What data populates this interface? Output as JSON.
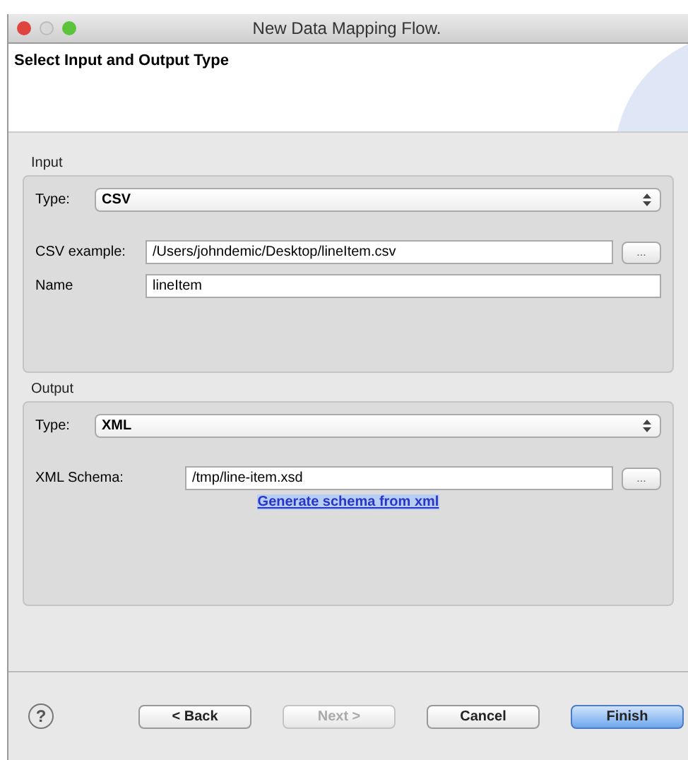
{
  "window": {
    "title": "New Data Mapping Flow."
  },
  "header": {
    "title": "Select Input and Output Type"
  },
  "input": {
    "legend": "Input",
    "type_label": "Type:",
    "type_value": "CSV",
    "fields": [
      {
        "label": "CSV example:",
        "value": "/Users/johndemic/Desktop/lineItem.csv",
        "browse": "..."
      },
      {
        "label": "Name",
        "value": "lineItem"
      }
    ]
  },
  "output": {
    "legend": "Output",
    "type_label": "Type:",
    "type_value": "XML",
    "fields": [
      {
        "label": "XML Schema:",
        "value": "/tmp/line-item.xsd",
        "browse": "..."
      }
    ],
    "link": "Generate schema from xml"
  },
  "help": "?",
  "buttons": [
    {
      "label": "< Back",
      "disabled": false,
      "default": false
    },
    {
      "label": "Next >",
      "disabled": true,
      "default": false
    },
    {
      "label": "Cancel",
      "disabled": false,
      "default": false
    },
    {
      "label": "Finish",
      "disabled": false,
      "default": true
    }
  ]
}
